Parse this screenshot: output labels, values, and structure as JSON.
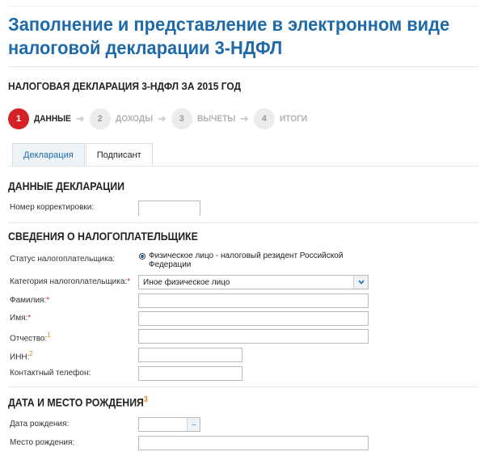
{
  "page": {
    "title": "Заполнение и представление в электронном виде налоговой декларации 3-НДФЛ"
  },
  "declaration": {
    "header": "НАЛОГОВАЯ ДЕКЛАРАЦИЯ 3-НДФЛ ЗА 2015 ГОД"
  },
  "steps": [
    {
      "number": "1",
      "label": "ДАННЫЕ",
      "active": true
    },
    {
      "number": "2",
      "label": "ДОХОДЫ",
      "active": false
    },
    {
      "number": "3",
      "label": "ВЫЧЕТЫ",
      "active": false
    },
    {
      "number": "4",
      "label": "ИТОГИ",
      "active": false
    }
  ],
  "tabs": [
    {
      "label": "Декларация",
      "active": true
    },
    {
      "label": "Подписант",
      "active": false
    }
  ],
  "sections": {
    "declaration_data": {
      "title": "ДАННЫЕ ДЕКЛАРАЦИИ",
      "correction_label": "Номер корректировки:",
      "correction_value": ""
    },
    "taxpayer": {
      "title": "СВЕДЕНИЯ О НАЛОГОПЛАТЕЛЬЩИКЕ",
      "status_label": "Статус налогоплательщика:",
      "status_value": "Физическое лицо - налоговый резидент Российской Федерации",
      "category_label": "Категория налогоплательщика:",
      "category_marker": "*",
      "category_value": "Иное физическое лицо",
      "surname_label": "Фамилия:",
      "surname_marker": "*",
      "name_label": "Имя:",
      "name_marker": "*",
      "patronymic_label": "Отчество:",
      "patronymic_marker": "1",
      "inn_label": "ИНН:",
      "inn_marker": "2",
      "phone_label": "Контактный телефон:"
    },
    "birth": {
      "title": "ДАТА И МЕСТО РОЖДЕНИЯ",
      "title_marker": "3",
      "date_label": "Дата рождения:",
      "date_button": "...",
      "place_label": "Место рождения:"
    }
  },
  "colors": {
    "title_blue": "#1f6aa8",
    "active_step_red": "#d52127",
    "required_orange": "#e8831f"
  }
}
